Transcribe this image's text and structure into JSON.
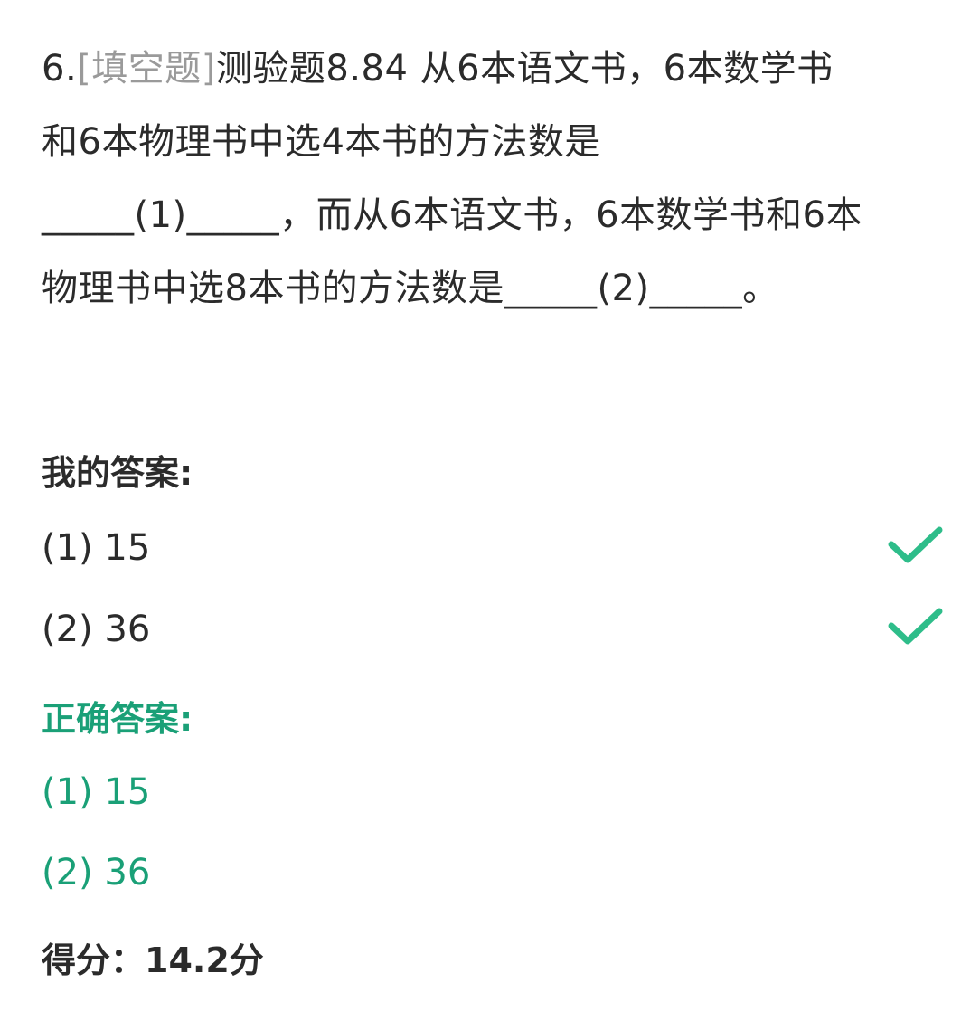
{
  "question": {
    "number": "6.",
    "type_tag": "[填空题]",
    "lines": [
      "测验题8.84 从6本语文书，6本数学书",
      "和6本物理书中选4本书的方法数是",
      "_____(1)_____，而从6本语文书，6本数学书和6本",
      "物理书中选8本书的方法数是_____(2)_____。"
    ]
  },
  "my_answer": {
    "title": "我的答案:",
    "items": [
      {
        "label": "(1) 15",
        "status_icon": "check-icon",
        "correct": true
      },
      {
        "label": "(2) 36",
        "status_icon": "check-icon",
        "correct": true
      }
    ]
  },
  "correct_answer": {
    "title": "正确答案:",
    "items": [
      {
        "label": "(1) 15"
      },
      {
        "label": "(2) 36"
      }
    ]
  },
  "score": {
    "text": "得分：14.2分"
  },
  "colors": {
    "text": "#2b2b2b",
    "tag": "#9a9a9a",
    "accent_green": "#1aa077",
    "check_green": "#2ebd8a",
    "background": "#ffffff"
  }
}
